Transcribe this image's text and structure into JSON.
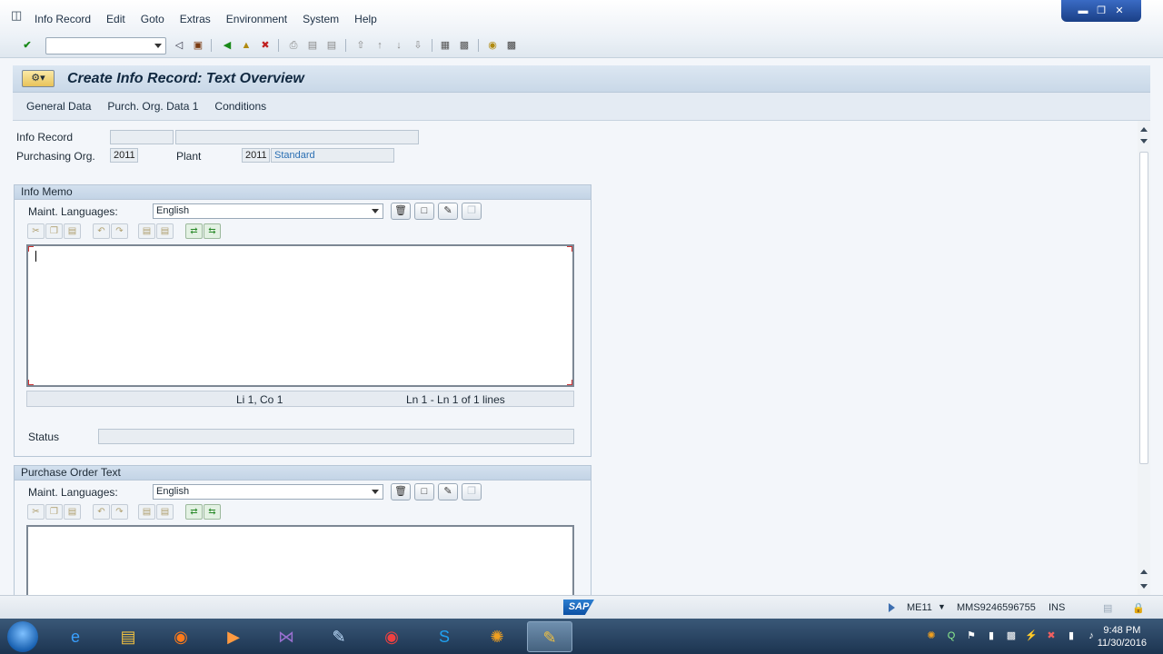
{
  "menu": {
    "items": [
      "Info Record",
      "Edit",
      "Goto",
      "Extras",
      "Environment",
      "System",
      "Help"
    ]
  },
  "title": {
    "text": "Create Info Record: Text Overview"
  },
  "app_toolbar": {
    "buttons": [
      "General Data",
      "Purch. Org. Data 1",
      "Conditions"
    ]
  },
  "header_fields": {
    "info_record_label": "Info Record",
    "info_record_value": "",
    "purch_org_label": "Purchasing Org.",
    "purch_org_value": "2011",
    "plant_label": "Plant",
    "plant_value": "2011",
    "plant_desc": "Standard"
  },
  "info_memo": {
    "title": "Info Memo",
    "lang_label": "Maint. Languages:",
    "lang_value": "English",
    "cursor_pos": "Li 1, Co 1",
    "line_info": "Ln 1 - Ln 1 of 1 lines",
    "status_label": "Status"
  },
  "po_text": {
    "title": "Purchase Order Text",
    "lang_label": "Maint. Languages:",
    "lang_value": "English"
  },
  "statusbar": {
    "logo": "SAP",
    "tcode": "ME11",
    "system": "MMS9246596755",
    "mode": "INS"
  },
  "taskbar": {
    "time": "9:48 PM",
    "date": "11/30/2016"
  },
  "colors": {
    "title_gradient_top": "#dce7f2",
    "accent_blue": "#2b6fb3",
    "taskbar": "#1c3450"
  }
}
